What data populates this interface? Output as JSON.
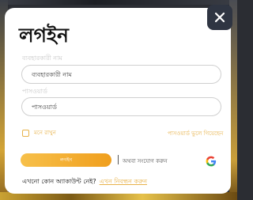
{
  "login": {
    "title": "লগইন",
    "username_label": "ব্যবহারকারী নাম",
    "username_placeholder": "ব্যবহারকারী নাম",
    "password_label": "পাসওয়ার্ড",
    "password_placeholder": "পাসওয়ার্ড",
    "remember_label": "মনে রাখুন",
    "forgot_label": "পাসওয়ার্ড ভুলে গিয়েছেন",
    "login_button": "লগইন",
    "social_label": "অথবা সংযোগ করুন",
    "no_account_text": "এখনো কোন অ্যাকাউন্ট নেই?",
    "register_link": "এখন নিবন্ধন করুন"
  },
  "icons": {
    "close": "close-icon",
    "google": "google-icon"
  },
  "colors": {
    "accent": "#e7b24a",
    "button_start": "#f7c04a",
    "button_end": "#f09f1e",
    "close_bg": "#2f3542"
  }
}
